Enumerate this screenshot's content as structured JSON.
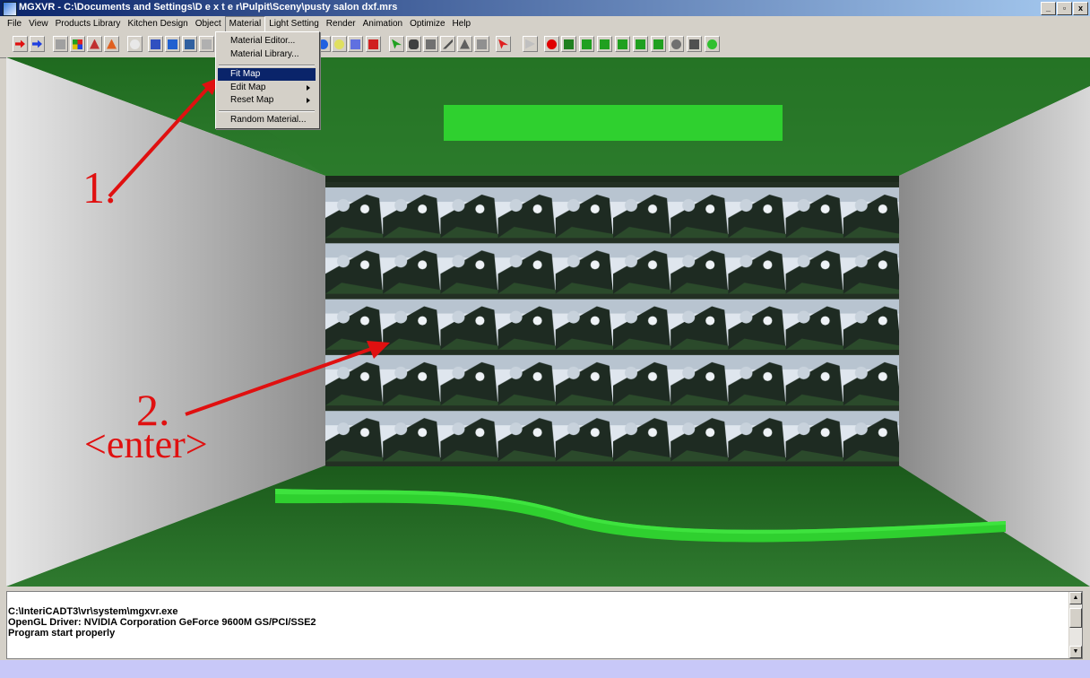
{
  "window": {
    "title": "MGXVR - C:\\Documents and Settings\\D e x t e r\\Pulpit\\Sceny\\pusty salon dxf.mrs",
    "minimize": "_",
    "restore": "▫",
    "close": "x"
  },
  "menubar": [
    "File",
    "View",
    "Products Library",
    "Kitchen Design",
    "Object",
    "Material",
    "Light Setting",
    "Render",
    "Animation",
    "Optimize",
    "Help"
  ],
  "material_menu": {
    "items": [
      "Material Editor...",
      "Material Library...",
      "Fit Map",
      "Edit Map",
      "Reset Map",
      "Random Material..."
    ],
    "selected": "Fit Map"
  },
  "toolbar_icons": [
    "arrow-right-red",
    "arrow-right-blue",
    "cube-gray",
    "multi-color",
    "pyramid-icon",
    "pyramid-red",
    "circle-icon",
    "box-blue",
    "box-solid",
    "view-icon",
    "grid-icon",
    "icon-11",
    "icon-12",
    "icon-13",
    "icon-14",
    "bulb-blue",
    "light-icon",
    "picture-icon",
    "cursor-icon",
    "knob-icon",
    "book-icon",
    "pen-icon",
    "triangle-icon",
    "building-icon",
    "select-icon",
    "play-icon",
    "record-icon",
    "camera-icon",
    "cube-1",
    "cube-2",
    "cube-3",
    "cube-4",
    "cube-5",
    "zoom-icon",
    "disk-icon",
    "refresh-icon"
  ],
  "annotations": {
    "step1": "1.",
    "step2": "2.",
    "step2_key": "<enter>"
  },
  "console": {
    "lines": [
      "C:\\InteriCADT3\\vr\\system\\mgxvr.exe",
      "OpenGL Driver: NVIDIA Corporation GeForce 9600M GS/PCI/SSE2",
      "Program start properly"
    ]
  },
  "colors": {
    "title_start": "#0a246a",
    "title_end": "#a6caf0",
    "floor_green": "#2e6e2e",
    "ceiling_green": "#2a7a2a",
    "strip_green": "#2fd02f",
    "wall_gray": "#a8a8a8",
    "annotation_red": "#e01010",
    "statusbar": "#c8c8f8"
  }
}
